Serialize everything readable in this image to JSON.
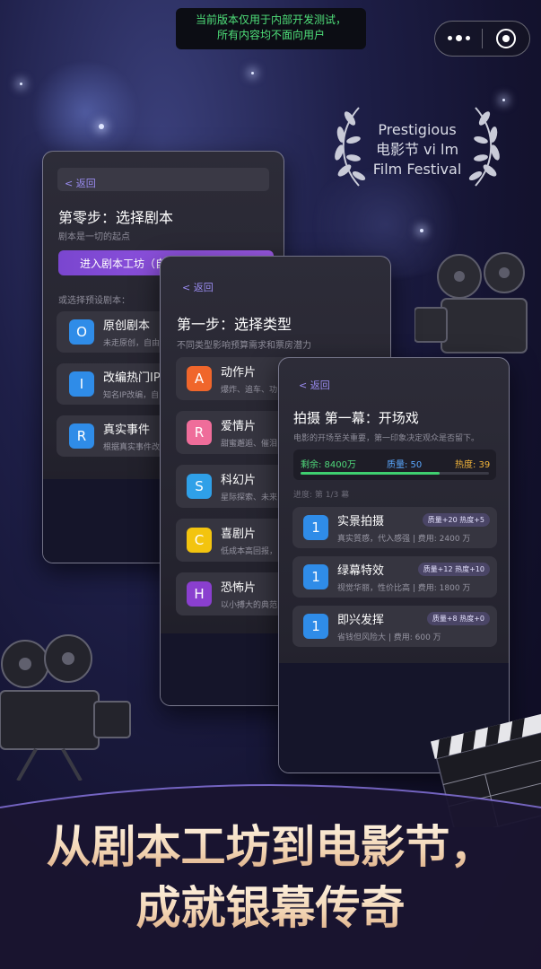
{
  "notice": {
    "line1": "当前版本仅用于内部开发测试，",
    "line2": "所有内容均不面向用户"
  },
  "capsule": {
    "menu_icon": "more-dots-icon",
    "close_icon": "target-close-icon"
  },
  "festival": {
    "line1": "Prestigious",
    "line2": "电影节 vi lm",
    "line3": "Film Festival"
  },
  "card0": {
    "back": "< 返回",
    "title": "第零步：选择剧本",
    "subtitle": "剧本是一切的起点",
    "workshop_button": "进入剧本工坊（自由",
    "section": "或选择预设剧本：",
    "items": [
      {
        "badge": "O",
        "name": "原创剧本",
        "desc": "未走原创，自由",
        "color": "#2f8ce8"
      },
      {
        "badge": "I",
        "name": "改编热门IP",
        "desc": "知名IP改编，自",
        "color": "#2f8ce8"
      },
      {
        "badge": "R",
        "name": "真实事件",
        "desc": "根据真实事件改",
        "color": "#2f8ce8"
      }
    ]
  },
  "card1": {
    "back": "< 返回",
    "title": "第一步：选择类型",
    "subtitle": "不同类型影响预算需求和票房潜力",
    "items": [
      {
        "badge": "A",
        "name": "动作片",
        "desc": "爆炸、追车、功",
        "color": "#f0662b"
      },
      {
        "badge": "R",
        "name": "爱情片",
        "desc": "甜蜜邂逅、催泪",
        "color": "#ef6d9a"
      },
      {
        "badge": "S",
        "name": "科幻片",
        "desc": "星际探索、未来",
        "color": "#2fa0e8"
      },
      {
        "badge": "C",
        "name": "喜剧片",
        "desc": "低成本高回报，",
        "color": "#f3c40f"
      },
      {
        "badge": "H",
        "name": "恐怖片",
        "desc": "以小搏大的典范",
        "color": "#8a3fcf"
      }
    ]
  },
  "card2": {
    "back": "< 返回",
    "title": "拍摄 第一幕：开场戏",
    "subtitle": "电影的开场至关重要，第一印象决定观众是否留下。",
    "stats": {
      "remaining": "剩余: 8400万",
      "quality": "质量: 50",
      "heat": "热度: 39",
      "progress_fraction": 0.74
    },
    "progress": "进度: 第 1/3 幕",
    "options": [
      {
        "badge": "1",
        "name": "实景拍摄",
        "desc": "真实質感，代入感强 | 费用: 2400 万",
        "tag": "质量+20 热度+5"
      },
      {
        "badge": "1",
        "name": "绿幕特效",
        "desc": "视觉华丽，性价比高 | 费用: 1800 万",
        "tag": "质量+12 热度+10"
      },
      {
        "badge": "1",
        "name": "即兴发挥",
        "desc": "省钱但风险大 | 费用: 600 万",
        "tag": "质量+8 热度+0"
      }
    ]
  },
  "headline": {
    "line1": "从剧本工坊到电影节，",
    "line2": "成就银幕传奇"
  }
}
